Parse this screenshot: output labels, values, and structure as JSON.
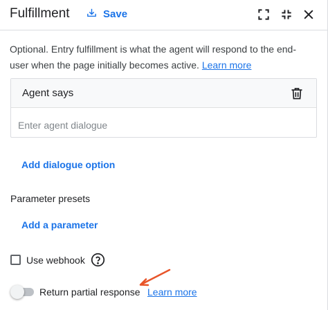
{
  "header": {
    "title": "Fulfillment",
    "save_label": "Save",
    "icons": [
      "save-icon",
      "fullscreen-icon",
      "collapse-icon",
      "close-icon"
    ]
  },
  "description": {
    "text": "Optional. Entry fulfillment is what the agent will respond to the end-user when the page initially becomes active.",
    "link_label": "Learn more"
  },
  "agent_card": {
    "title": "Agent says",
    "input_value": "",
    "input_placeholder": "Enter agent dialogue"
  },
  "actions": {
    "add_dialogue": "Add dialogue option",
    "add_parameter": "Add a parameter"
  },
  "parameter_presets": {
    "label": "Parameter presets"
  },
  "webhook": {
    "label": "Use webhook",
    "checked": false
  },
  "partial_response": {
    "label": "Return partial response",
    "enabled": false,
    "link_label": "Learn more"
  },
  "colors": {
    "accent": "#1a73e8",
    "annotation_arrow": "#e8552a"
  }
}
